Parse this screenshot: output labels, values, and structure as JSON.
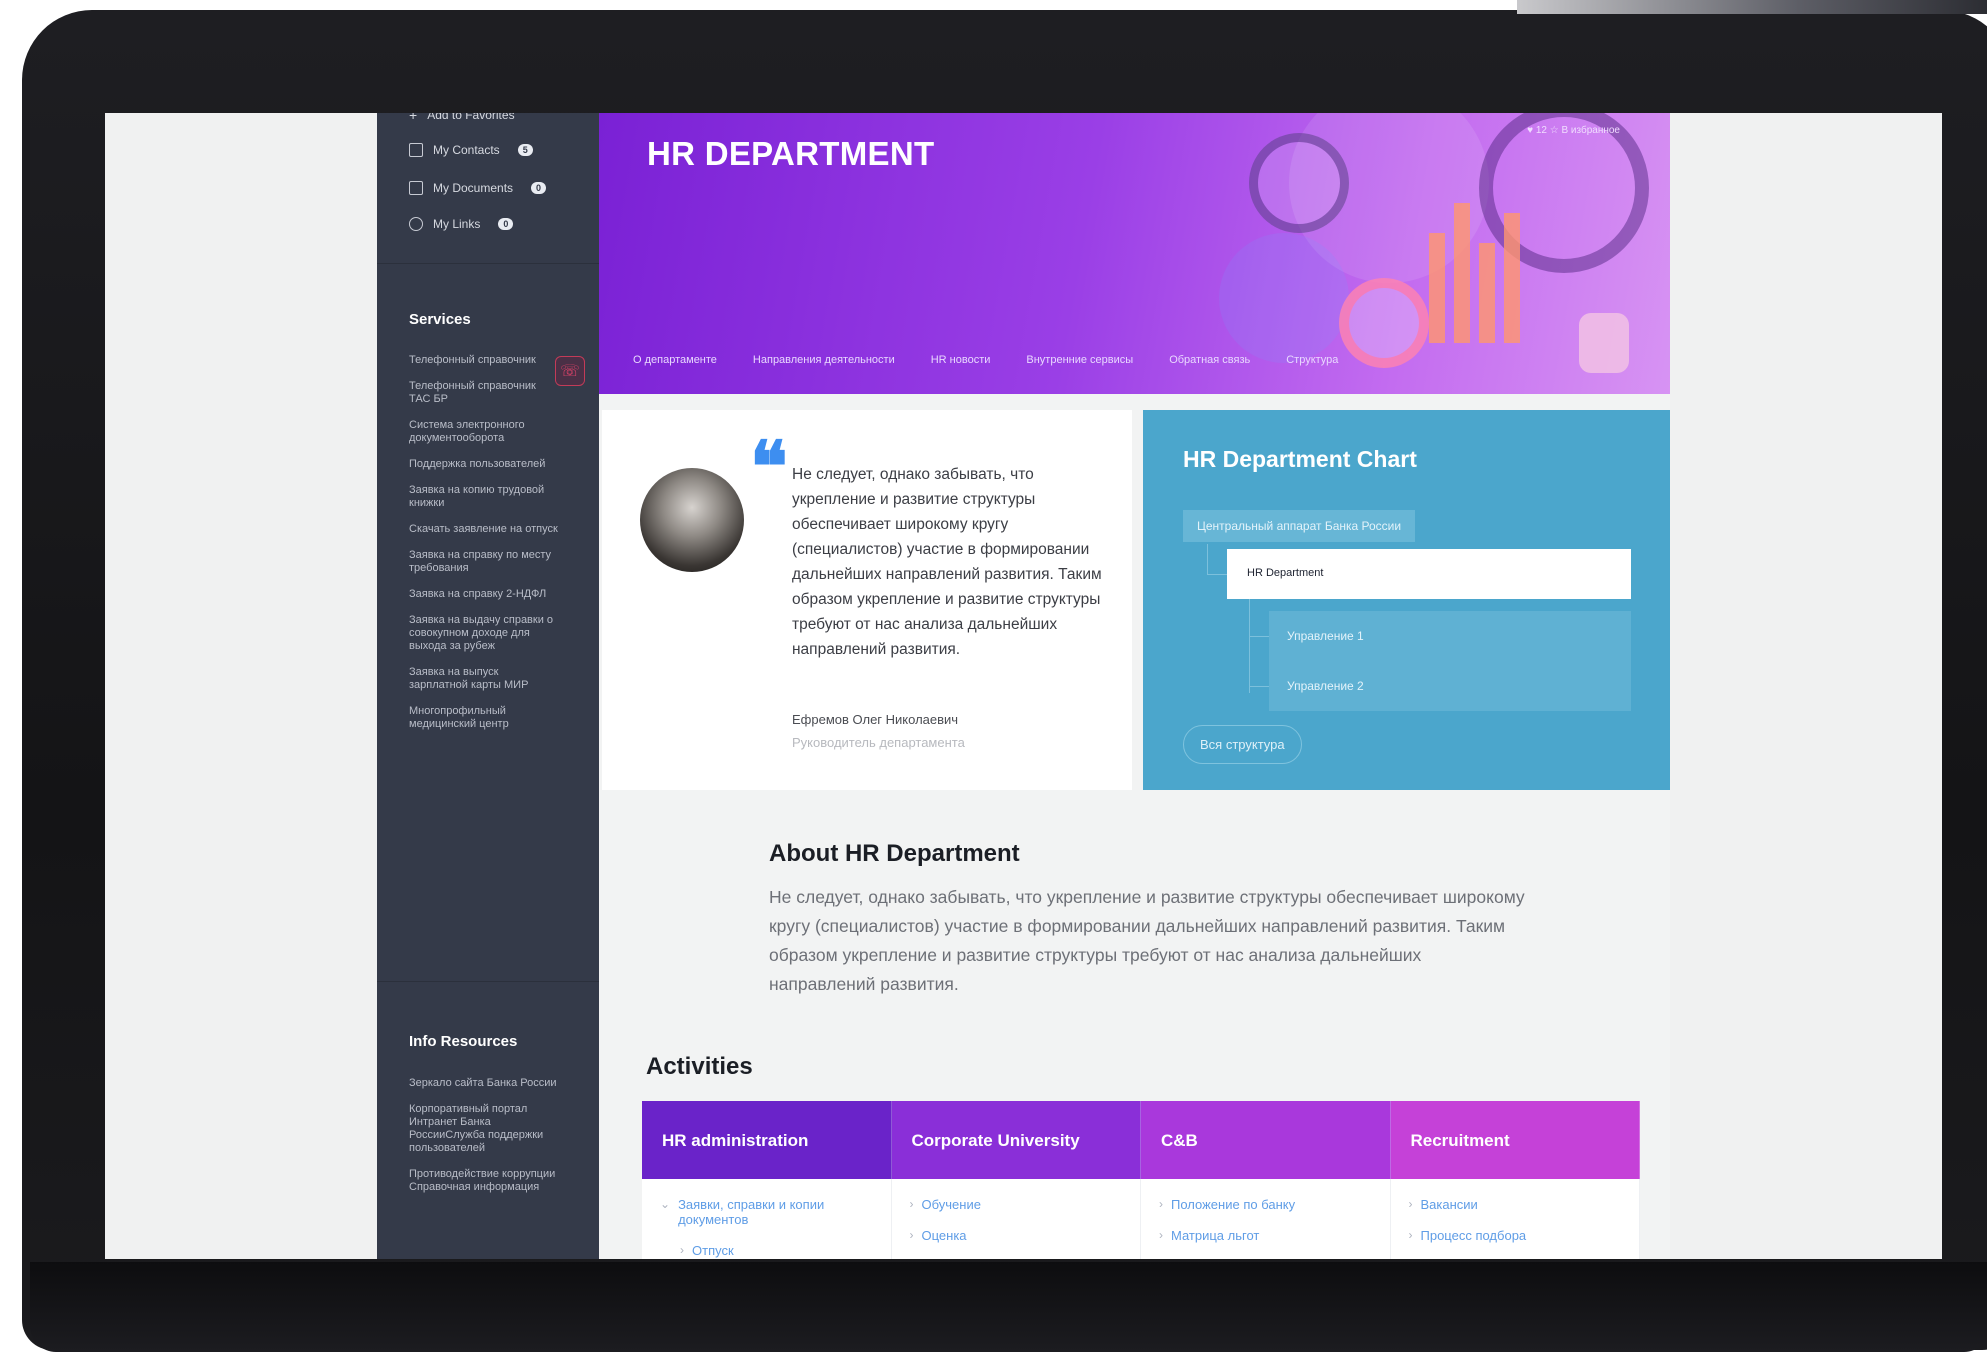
{
  "sidebar": {
    "favorites": [
      {
        "label": "Add to Favorites",
        "icon": "plus-icon"
      },
      {
        "label": "My Contacts",
        "icon": "contacts-icon",
        "badge": "5"
      },
      {
        "label": "My Documents",
        "icon": "documents-icon",
        "badge": "0"
      },
      {
        "label": "My Links",
        "icon": "link-icon",
        "badge": "0"
      }
    ],
    "services_title": "Services",
    "services": [
      "Телефонный справочник",
      "Телефонный справочник ТАС БР",
      "Система электронного документооборота",
      "Поддержка пользователей",
      "Заявка на копию трудовой книжки",
      "Скачать заявление на отпуск",
      "Заявка на справку по месту требования",
      "Заявка на справку 2-НДФЛ",
      "Заявка на выдачу справки о совокупном доходе для выхода за рубеж",
      "Заявка на выпуск зарплатной карты МИР",
      "Многопрофильный медицинский центр"
    ],
    "info_title": "Info Resources",
    "info": [
      "Зеркало сайта Банка России",
      "Корпоративный портал Интранет Банка РоссииСлужба поддержки пользователей",
      "Противодействие коррупции Справочная информация"
    ]
  },
  "hero": {
    "title": "HR DEPARTMENT",
    "top_right": "♥ 12    ☆ В избранное",
    "nav": [
      "О департаменте",
      "Направления деятельности",
      "HR новости",
      "Внутренние сервисы",
      "Обратная связь",
      "Структура"
    ],
    "colors": {
      "start": "#7a21d5",
      "end": "#d793f3"
    }
  },
  "quote": {
    "mark": "❝",
    "text": "Не следует, однако забывать, что укрепление и развитие структуры обеспечивает широкому кругу (специалистов) участие в формировании дальнейших направлений развития. Таким образом укрепление и развитие структуры требуют от нас анализа дальнейших направлений развития.",
    "name": "Ефремов Олег Николаевич",
    "role": "Руководитель департамента"
  },
  "chart": {
    "title": "HR Department Chart",
    "root": "Центральный аппарат Банка России",
    "department": "HR Department",
    "subs": [
      "Управление 1",
      "Управление 2"
    ],
    "button": "Вся структура",
    "color": "#4ba6cc"
  },
  "about": {
    "title": "About HR Department",
    "text": "Не следует, однако забывать, что укрепление и развитие структуры обеспечивает широкому кругу (специалистов) участие в формировании дальнейших направлений развития. Таким образом укрепление и развитие структуры требуют от нас анализа дальнейших направлений развития."
  },
  "activities": {
    "title": "Activities",
    "columns": [
      {
        "header": "HR administration",
        "color": "#6a23c9",
        "links": [
          "Заявки, справки и копии документов",
          "Отпуск"
        ]
      },
      {
        "header": "Corporate University",
        "color": "#8a2fd8",
        "links": [
          "Обучение",
          "Оценка"
        ]
      },
      {
        "header": "C&B",
        "color": "#a938dc",
        "links": [
          "Положение по банку",
          "Матрица льгот"
        ]
      },
      {
        "header": "Recruitment",
        "color": "#c541d8",
        "links": [
          "Вакансии",
          "Процесс подбора"
        ]
      }
    ]
  }
}
